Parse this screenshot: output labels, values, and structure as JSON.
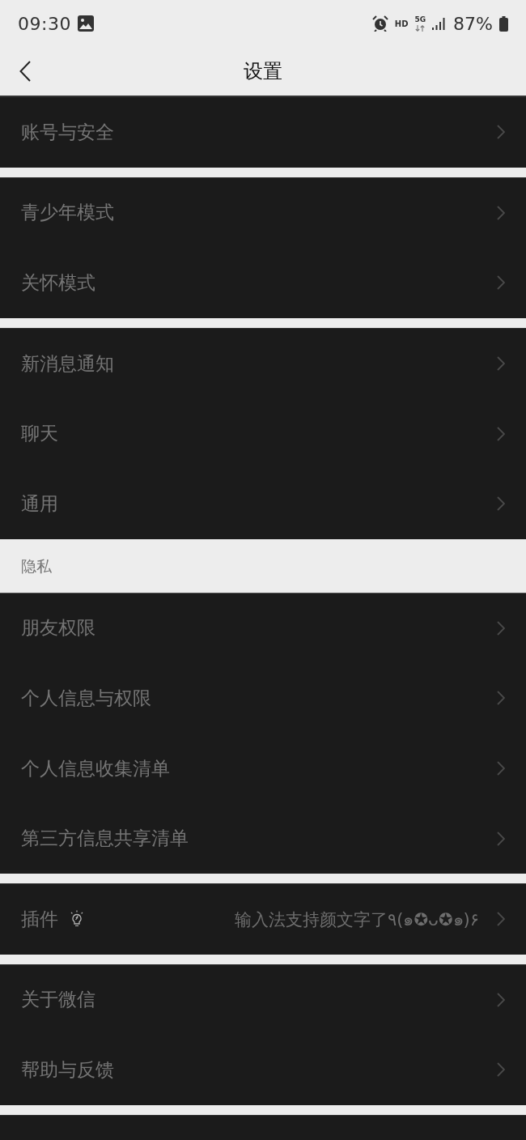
{
  "status_bar": {
    "time": "09:30",
    "indicators": [
      {
        "kind": "hd",
        "text": "HD"
      },
      {
        "kind": "network",
        "text": "5G"
      }
    ],
    "battery": "87%"
  },
  "header": {
    "title": "设置"
  },
  "groups": [
    {
      "items": [
        {
          "kind": "link",
          "label": "账号与安全"
        }
      ]
    },
    {
      "items": [
        {
          "kind": "link",
          "label": "青少年模式"
        },
        {
          "kind": "link",
          "label": "关怀模式"
        }
      ]
    },
    {
      "items": [
        {
          "kind": "link",
          "label": "新消息通知"
        },
        {
          "kind": "link",
          "label": "聊天"
        },
        {
          "kind": "link",
          "label": "通用"
        }
      ]
    },
    {
      "title": "隐私",
      "items": [
        {
          "kind": "link",
          "label": "朋友权限"
        },
        {
          "kind": "link",
          "label": "个人信息与权限"
        },
        {
          "kind": "link",
          "label": "个人信息收集清单"
        },
        {
          "kind": "link",
          "label": "第三方信息共享清单"
        }
      ]
    },
    {
      "items": [
        {
          "kind": "plugin",
          "label": "插件",
          "status": "输入法支持颜文字了٩(๑✪ᴗ✪๑)۶"
        }
      ]
    },
    {
      "items": [
        {
          "kind": "link",
          "label": "关于微信"
        },
        {
          "kind": "link",
          "label": "帮助与反馈"
        }
      ]
    }
  ]
}
